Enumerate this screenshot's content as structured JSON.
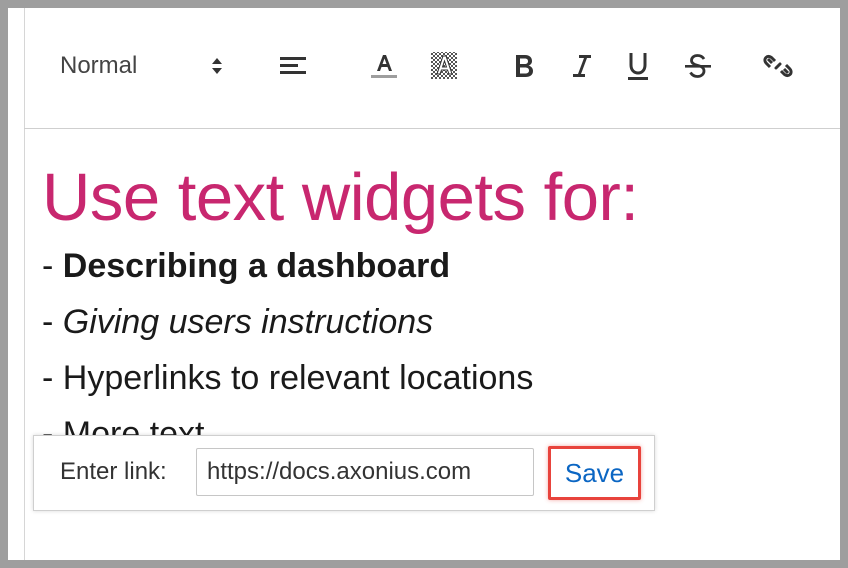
{
  "toolbar": {
    "format_select": "Normal",
    "icons": [
      "align-left-icon",
      "text-color-icon",
      "highlight-color-icon",
      "bold-icon",
      "italic-icon",
      "underline-icon",
      "strikethrough-icon",
      "link-icon"
    ]
  },
  "editor": {
    "heading": "Use text widgets for:",
    "lines": [
      {
        "prefix": "- ",
        "text": "Describing a dashboard",
        "style": "bold"
      },
      {
        "prefix": "- ",
        "text": "Giving users instructions",
        "style": "italic"
      },
      {
        "prefix": "- ",
        "text": "Hyperlinks to relevant locations",
        "style": "normal"
      },
      {
        "prefix": "- ",
        "text": "More text",
        "style": "normal"
      }
    ],
    "heading_color": "#c8276f"
  },
  "link_popup": {
    "label": "Enter link:",
    "input_value": "https://docs.axonius.com",
    "save_label": "Save",
    "save_color": "#0b66c3",
    "highlight_color": "#e8433c"
  }
}
